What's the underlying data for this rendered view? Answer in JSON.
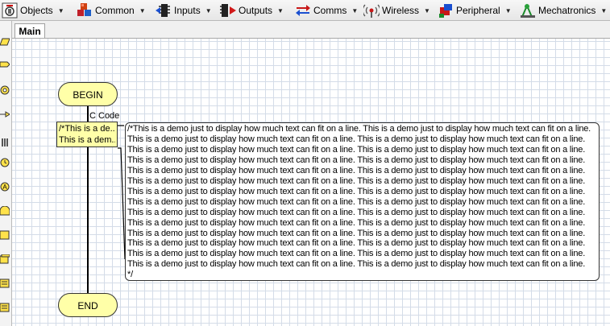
{
  "toolbar": {
    "items": [
      {
        "label": "Objects",
        "icon": "objects-icon"
      },
      {
        "label": "Common",
        "icon": "cubes-icon"
      },
      {
        "label": "Inputs",
        "icon": "chip-input-icon"
      },
      {
        "label": "Outputs",
        "icon": "chip-output-icon"
      },
      {
        "label": "Comms",
        "icon": "comms-arrows-icon"
      },
      {
        "label": "Wireless",
        "icon": "wireless-icon"
      },
      {
        "label": "Peripheral",
        "icon": "peripheral-icon"
      },
      {
        "label": "Mechatronics",
        "icon": "mechatronics-icon"
      }
    ]
  },
  "tabs": {
    "main": "Main"
  },
  "flowchart": {
    "begin": "BEGIN",
    "end": "END",
    "ccode_label": "C Code",
    "ccode_preview": [
      "/*This is a de...",
      "This is a dem..."
    ],
    "code_lines": [
      "/*This is a demo just to display how much text can fit on a line. This is a demo just to display how much text can fit on a line.",
      "This is a demo just to display how much text can fit on a line. This is a demo just to display how much text can fit on a line.",
      "This is a demo just to display how much text can fit on a line. This is a demo just to display how much text can fit on a line.",
      "This is a demo just to display how much text can fit on a line. This is a demo just to display how much text can fit on a line.",
      "This is a demo just to display how much text can fit on a line. This is a demo just to display how much text can fit on a line.",
      "This is a demo just to display how much text can fit on a line. This is a demo just to display how much text can fit on a line.",
      "This is a demo just to display how much text can fit on a line. This is a demo just to display how much text can fit on a line.",
      "This is a demo just to display how much text can fit on a line. This is a demo just to display how much text can fit on a line.",
      "This is a demo just to display how much text can fit on a line. This is a demo just to display how much text can fit on a line.",
      "This is a demo just to display how much text can fit on a line. This is a demo just to display how much text can fit on a line.",
      "This is a demo just to display how much text can fit on a line. This is a demo just to display how much text can fit on a line.",
      "This is a demo just to display how much text can fit on a line. This is a demo just to display how much text can fit on a line.",
      "This is a demo just to display how much text can fit on a line. This is a demo just to display how much text can fit on a line.",
      "This is a demo just to display how much text can fit on a line. This is a demo just to display how much text can fit on a line.",
      "*/"
    ]
  },
  "colors": {
    "terminal_fill": "#ffffa8",
    "grid": "#d4dce8"
  }
}
